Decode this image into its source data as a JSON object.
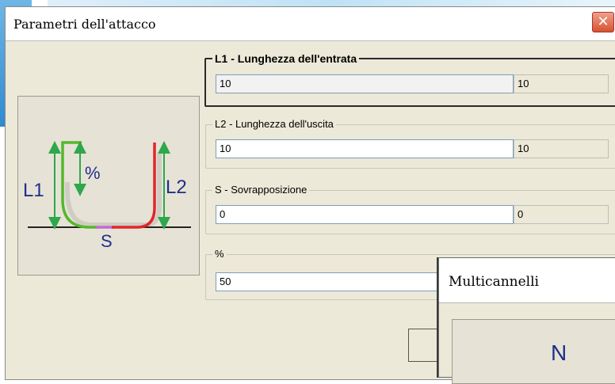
{
  "dialog": {
    "title": "Parametri dell'attacco",
    "close_glyph": "✕",
    "illustration": {
      "label_l1": "L1",
      "label_l2": "L2",
      "label_pct": "%",
      "label_s": "S"
    },
    "groups": [
      {
        "legend": "L1 - Lunghezza dell'entrata",
        "value": "10",
        "readout": "10"
      },
      {
        "legend": "L2 - Lunghezza dell'uscita",
        "value": "10",
        "readout": "10"
      },
      {
        "legend": "S - Sovrapposizione",
        "value": "0",
        "readout": "0"
      },
      {
        "legend": "%",
        "value": "50"
      }
    ]
  },
  "popup": {
    "title": "Multicannelli",
    "panel_letter": "N"
  }
}
